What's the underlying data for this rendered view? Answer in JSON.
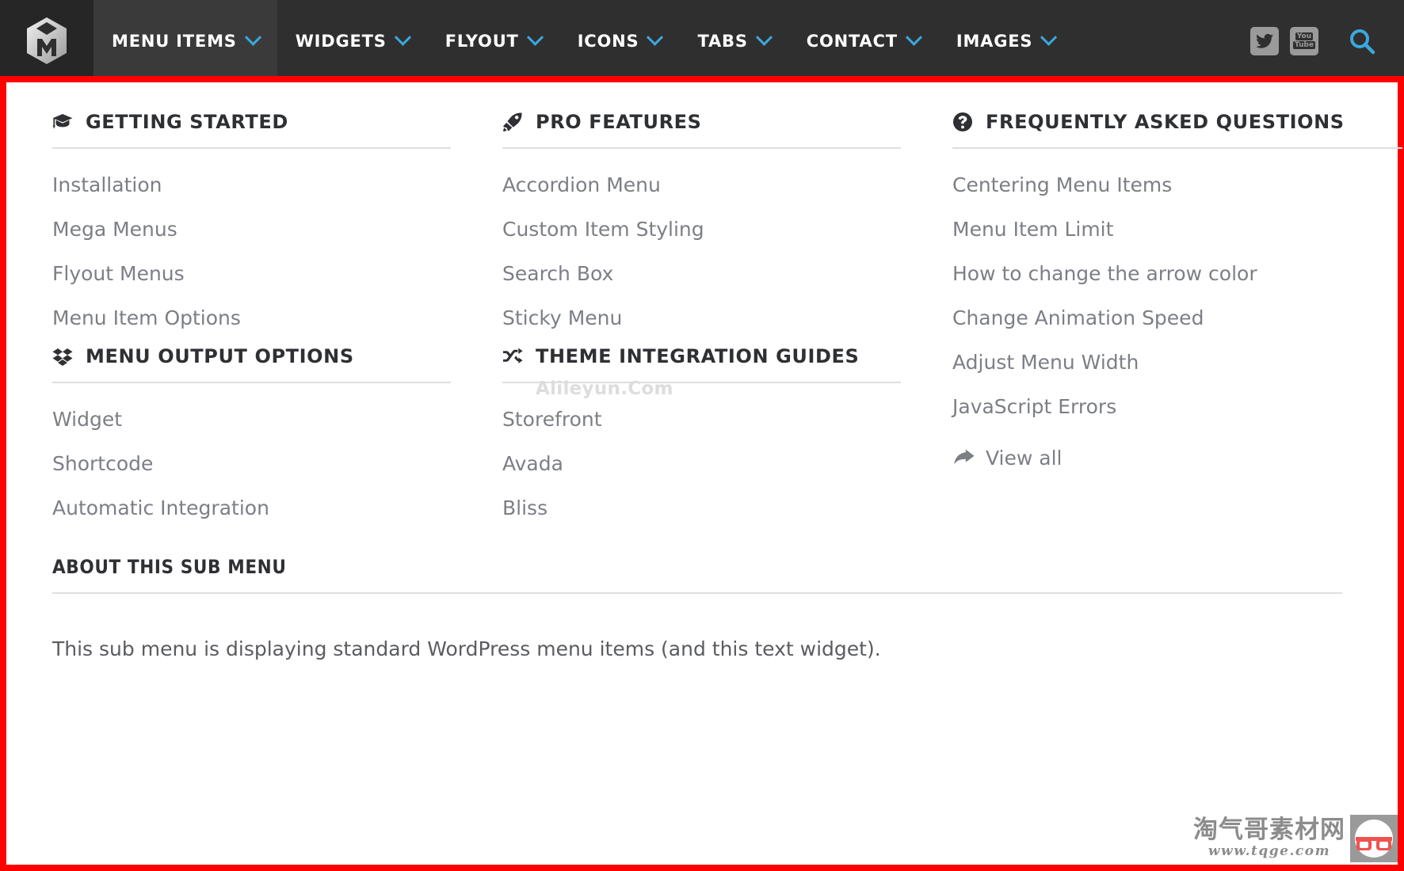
{
  "navbar": {
    "logo_name": "max-mega-menu-logo",
    "items": [
      {
        "label": "MENU ITEMS",
        "active": true,
        "icon": "chevron-down-icon"
      },
      {
        "label": "WIDGETS",
        "active": false,
        "icon": "chevron-down-icon"
      },
      {
        "label": "FLYOUT",
        "active": false,
        "icon": "chevron-down-icon"
      },
      {
        "label": "ICONS",
        "active": false,
        "icon": "chevron-down-icon"
      },
      {
        "label": "TABS",
        "active": false,
        "icon": "chevron-down-icon"
      },
      {
        "label": "CONTACT",
        "active": false,
        "icon": "chevron-down-icon"
      },
      {
        "label": "IMAGES",
        "active": false,
        "icon": "chevron-down-icon"
      }
    ],
    "social": [
      {
        "name": "twitter-icon",
        "label": "Twitter"
      },
      {
        "name": "youtube-icon",
        "label": "You Tube",
        "line1": "You",
        "line2": "Tube"
      }
    ],
    "search": {
      "name": "search-icon",
      "label": "Search"
    },
    "colors": {
      "bar_bg": "#2f2f2f",
      "logo_bg": "#262626",
      "active_bg": "#3a3a3a",
      "chevron": "#3ba8dd",
      "search": "#3ba8dd",
      "social_bg": "#9a9a9a"
    }
  },
  "panel": {
    "border_color": "#fe0000",
    "columns": [
      {
        "widgets": [
          {
            "title": "GETTING STARTED",
            "icon": "graduation-cap-icon",
            "links": [
              "Installation",
              "Mega Menus",
              "Flyout Menus",
              "Menu Item Options"
            ]
          },
          {
            "title": "MENU OUTPUT OPTIONS",
            "icon": "dropbox-icon",
            "links": [
              "Widget",
              "Shortcode",
              "Automatic Integration"
            ]
          }
        ]
      },
      {
        "widgets": [
          {
            "title": "PRO FEATURES",
            "icon": "rocket-icon",
            "links": [
              "Accordion Menu",
              "Custom Item Styling",
              "Search Box",
              "Sticky Menu"
            ]
          },
          {
            "title": "THEME INTEGRATION GUIDES",
            "icon": "shuffle-icon",
            "links": [
              "Storefront",
              "Avada",
              "Bliss"
            ]
          }
        ]
      },
      {
        "widgets": [
          {
            "title": "FREQUENTLY ASKED QUESTIONS",
            "icon": "question-circle-icon",
            "links": [
              "Centering Menu Items",
              "Menu Item Limit",
              "How to change the arrow color",
              "Change Animation Speed",
              "Adjust Menu Width",
              "JavaScript Errors"
            ],
            "view_all": {
              "label": "View all",
              "icon": "share-arrow-icon"
            }
          }
        ]
      }
    ],
    "about": {
      "title": "ABOUT THIS SUB MENU",
      "text": "This sub menu is displaying standard WordPress menu items (and this text widget)."
    }
  },
  "watermarks": {
    "center": "Alileyun.Com",
    "corner_cn": "淘气哥素材网",
    "corner_url": "www.tqge.com",
    "corner_logo": "glasses-logo-icon"
  }
}
